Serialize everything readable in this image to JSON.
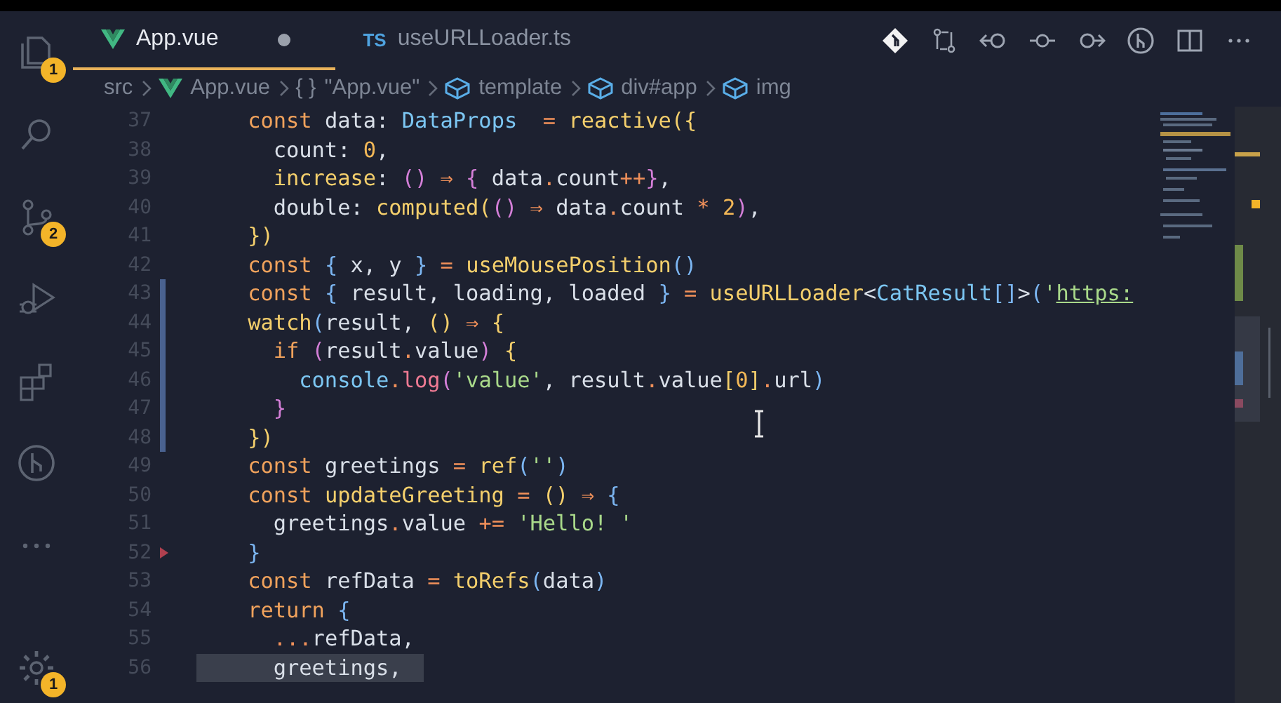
{
  "activity_bar": {
    "items": [
      {
        "kind": "files",
        "badge": "1"
      },
      {
        "kind": "search"
      },
      {
        "kind": "source-control",
        "badge": "2"
      },
      {
        "kind": "run-debug"
      },
      {
        "kind": "extensions"
      },
      {
        "kind": "git-graph"
      },
      {
        "kind": "more"
      }
    ],
    "bottom_items": [
      {
        "kind": "settings",
        "badge": "1"
      }
    ]
  },
  "tabs": [
    {
      "label": "App.vue",
      "kind": "vue",
      "selected": true,
      "dirty": true
    },
    {
      "label": "useURLLoader.ts",
      "kind": "ts",
      "badge": "TS",
      "selected": false,
      "dirty": false
    }
  ],
  "toolbar": [
    {
      "kind": "git-diamond"
    },
    {
      "kind": "compare"
    },
    {
      "kind": "back"
    },
    {
      "kind": "commit"
    },
    {
      "kind": "forward"
    },
    {
      "kind": "git-graph"
    },
    {
      "kind": "split"
    },
    {
      "kind": "more"
    }
  ],
  "breadcrumbs": [
    {
      "label": "src",
      "kind": "folder"
    },
    {
      "label": "App.vue",
      "kind": "vue"
    },
    {
      "label": "\"App.vue\"",
      "kind": "braces",
      "symbol": "{ }"
    },
    {
      "label": "template",
      "kind": "element"
    },
    {
      "label": "div#app",
      "kind": "element"
    },
    {
      "label": "img",
      "kind": "element"
    }
  ],
  "editor": {
    "lines": [
      {
        "number": "37",
        "modified": false,
        "deleted": false,
        "highlighted": false,
        "tokens": [
          {
            "text": "    const",
            "kind": "kw"
          },
          {
            "text": " data: ",
            "kind": "id"
          },
          {
            "text": "DataProps",
            "kind": "type"
          },
          {
            "text": "  =",
            "kind": "op"
          },
          {
            "text": " reactive",
            "kind": "fn"
          },
          {
            "text": "({",
            "kind": "p1"
          }
        ]
      },
      {
        "number": "38",
        "modified": false,
        "deleted": false,
        "highlighted": false,
        "tokens": [
          {
            "text": "      count: ",
            "kind": "id"
          },
          {
            "text": "0",
            "kind": "num"
          },
          {
            "text": ",",
            "kind": "id"
          }
        ]
      },
      {
        "number": "39",
        "modified": false,
        "deleted": false,
        "highlighted": false,
        "tokens": [
          {
            "text": "      increase",
            "kind": "fn"
          },
          {
            "text": ": ",
            "kind": "id"
          },
          {
            "text": "()",
            "kind": "p2"
          },
          {
            "text": " ⇒ ",
            "kind": "op"
          },
          {
            "text": "{",
            "kind": "p2"
          },
          {
            "text": " data",
            "kind": "id"
          },
          {
            "text": ".",
            "kind": "op"
          },
          {
            "text": "count",
            "kind": "id"
          },
          {
            "text": "++",
            "kind": "op"
          },
          {
            "text": "}",
            "kind": "p2"
          },
          {
            "text": ",",
            "kind": "id"
          }
        ]
      },
      {
        "number": "40",
        "modified": false,
        "deleted": false,
        "highlighted": false,
        "tokens": [
          {
            "text": "      double: ",
            "kind": "id"
          },
          {
            "text": "computed",
            "kind": "fn"
          },
          {
            "text": "(",
            "kind": "p1"
          },
          {
            "text": "()",
            "kind": "p2"
          },
          {
            "text": " ⇒ ",
            "kind": "op"
          },
          {
            "text": "data",
            "kind": "id"
          },
          {
            "text": ".",
            "kind": "op"
          },
          {
            "text": "count ",
            "kind": "id"
          },
          {
            "text": "* ",
            "kind": "op"
          },
          {
            "text": "2",
            "kind": "num"
          },
          {
            "text": ")",
            "kind": "p2"
          },
          {
            "text": ",",
            "kind": "id"
          }
        ]
      },
      {
        "number": "41",
        "modified": false,
        "deleted": false,
        "highlighted": false,
        "tokens": [
          {
            "text": "    })",
            "kind": "p1"
          }
        ]
      },
      {
        "number": "42",
        "modified": false,
        "deleted": false,
        "highlighted": false,
        "tokens": [
          {
            "text": "    const",
            "kind": "kw"
          },
          {
            "text": " {",
            "kind": "p3"
          },
          {
            "text": " x, y ",
            "kind": "id"
          },
          {
            "text": "}",
            "kind": "p3"
          },
          {
            "text": " =",
            "kind": "op"
          },
          {
            "text": " useMousePosition",
            "kind": "fn"
          },
          {
            "text": "()",
            "kind": "p3"
          }
        ]
      },
      {
        "number": "43",
        "modified": true,
        "deleted": false,
        "highlighted": false,
        "tokens": [
          {
            "text": "    const",
            "kind": "kw"
          },
          {
            "text": " {",
            "kind": "p3"
          },
          {
            "text": " result, loading, loaded ",
            "kind": "id"
          },
          {
            "text": "}",
            "kind": "p3"
          },
          {
            "text": " =",
            "kind": "op"
          },
          {
            "text": " useURLLoader",
            "kind": "fn"
          },
          {
            "text": "<",
            "kind": "id"
          },
          {
            "text": "CatResult",
            "kind": "type"
          },
          {
            "text": "[]",
            "kind": "p3"
          },
          {
            "text": ">",
            "kind": "id"
          },
          {
            "text": "(",
            "kind": "p3"
          },
          {
            "text": "'",
            "kind": "str"
          },
          {
            "text": "https:",
            "kind": "link"
          }
        ]
      },
      {
        "number": "44",
        "modified": true,
        "deleted": false,
        "highlighted": false,
        "tokens": [
          {
            "text": "    watch",
            "kind": "fn"
          },
          {
            "text": "(",
            "kind": "p3"
          },
          {
            "text": "result, ",
            "kind": "id"
          },
          {
            "text": "()",
            "kind": "p1"
          },
          {
            "text": " ⇒ ",
            "kind": "op"
          },
          {
            "text": "{",
            "kind": "p1"
          }
        ]
      },
      {
        "number": "45",
        "modified": true,
        "deleted": false,
        "highlighted": false,
        "tokens": [
          {
            "text": "      if",
            "kind": "kw"
          },
          {
            "text": " (",
            "kind": "p2"
          },
          {
            "text": "result",
            "kind": "id"
          },
          {
            "text": ".",
            "kind": "op"
          },
          {
            "text": "value",
            "kind": "id"
          },
          {
            "text": ")",
            "kind": "p2"
          },
          {
            "text": " {",
            "kind": "p1"
          }
        ]
      },
      {
        "number": "46",
        "modified": true,
        "deleted": false,
        "highlighted": false,
        "tokens": [
          {
            "text": "        console",
            "kind": "type"
          },
          {
            "text": ".",
            "kind": "op"
          },
          {
            "text": "log",
            "kind": "log"
          },
          {
            "text": "(",
            "kind": "p2"
          },
          {
            "text": "'value'",
            "kind": "str"
          },
          {
            "text": ", result",
            "kind": "id"
          },
          {
            "text": ".",
            "kind": "op"
          },
          {
            "text": "value",
            "kind": "id"
          },
          {
            "text": "[",
            "kind": "p1"
          },
          {
            "text": "0",
            "kind": "num"
          },
          {
            "text": "]",
            "kind": "p1"
          },
          {
            "text": ".",
            "kind": "op"
          },
          {
            "text": "url",
            "kind": "id"
          },
          {
            "text": ")",
            "kind": "p3"
          }
        ]
      },
      {
        "number": "47",
        "modified": true,
        "deleted": false,
        "highlighted": false,
        "tokens": [
          {
            "text": "      }",
            "kind": "p2"
          }
        ]
      },
      {
        "number": "48",
        "modified": true,
        "deleted": false,
        "highlighted": false,
        "tokens": [
          {
            "text": "    })",
            "kind": "p1"
          }
        ]
      },
      {
        "number": "49",
        "modified": false,
        "deleted": false,
        "highlighted": false,
        "tokens": [
          {
            "text": "    const",
            "kind": "kw"
          },
          {
            "text": " greetings ",
            "kind": "id"
          },
          {
            "text": "=",
            "kind": "op"
          },
          {
            "text": " ref",
            "kind": "fn"
          },
          {
            "text": "(",
            "kind": "p3"
          },
          {
            "text": "''",
            "kind": "str"
          },
          {
            "text": ")",
            "kind": "p3"
          }
        ]
      },
      {
        "number": "50",
        "modified": false,
        "deleted": false,
        "highlighted": false,
        "tokens": [
          {
            "text": "    const",
            "kind": "kw"
          },
          {
            "text": " updateGreeting",
            "kind": "fn"
          },
          {
            "text": " =",
            "kind": "op"
          },
          {
            "text": " ()",
            "kind": "p1"
          },
          {
            "text": " ⇒ ",
            "kind": "op"
          },
          {
            "text": "{",
            "kind": "p3"
          }
        ]
      },
      {
        "number": "51",
        "modified": false,
        "deleted": false,
        "highlighted": false,
        "tokens": [
          {
            "text": "      greetings",
            "kind": "id"
          },
          {
            "text": ".",
            "kind": "op"
          },
          {
            "text": "value ",
            "kind": "id"
          },
          {
            "text": "+=",
            "kind": "op"
          },
          {
            "text": " 'Hello! '",
            "kind": "str"
          }
        ]
      },
      {
        "number": "52",
        "modified": false,
        "deleted": true,
        "highlighted": false,
        "tokens": [
          {
            "text": "    }",
            "kind": "p3"
          }
        ]
      },
      {
        "number": "53",
        "modified": false,
        "deleted": false,
        "highlighted": false,
        "tokens": [
          {
            "text": "    const",
            "kind": "kw"
          },
          {
            "text": " refData ",
            "kind": "id"
          },
          {
            "text": "=",
            "kind": "op"
          },
          {
            "text": " toRefs",
            "kind": "fn"
          },
          {
            "text": "(",
            "kind": "p3"
          },
          {
            "text": "data",
            "kind": "id"
          },
          {
            "text": ")",
            "kind": "p3"
          }
        ]
      },
      {
        "number": "54",
        "modified": false,
        "deleted": false,
        "highlighted": false,
        "tokens": [
          {
            "text": "    return",
            "kind": "kw"
          },
          {
            "text": " {",
            "kind": "p3"
          }
        ]
      },
      {
        "number": "55",
        "modified": false,
        "deleted": false,
        "highlighted": false,
        "tokens": [
          {
            "text": "      ...",
            "kind": "op"
          },
          {
            "text": "refData,",
            "kind": "id"
          }
        ]
      },
      {
        "number": "56",
        "modified": false,
        "deleted": false,
        "highlighted": true,
        "tokens": [
          {
            "text": "      greetings,",
            "kind": "id"
          }
        ]
      }
    ]
  }
}
